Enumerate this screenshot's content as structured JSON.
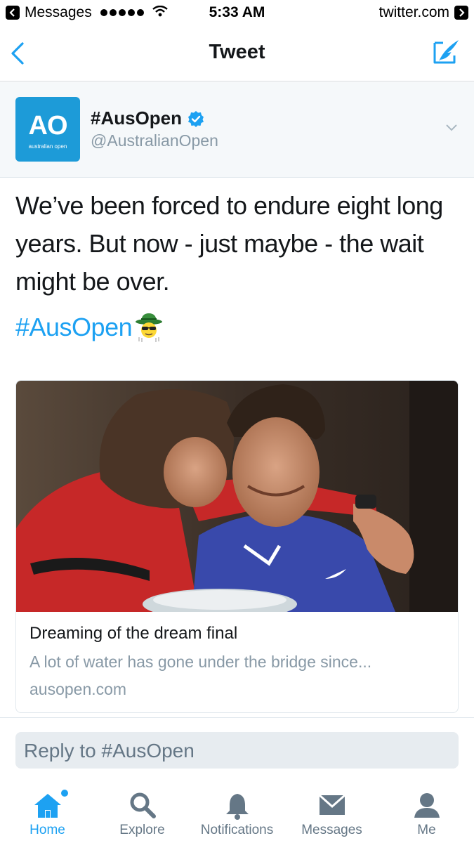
{
  "status_bar": {
    "back_app": "Messages",
    "time": "5:33 AM",
    "site": "twitter.com"
  },
  "nav": {
    "title": "Tweet"
  },
  "author": {
    "name": "#AusOpen",
    "handle": "@AustralianOpen",
    "avatar_text": "AO",
    "avatar_subtext": "australian open",
    "verified": true
  },
  "tweet": {
    "text": "We’ve been forced to endure eight long years. But now - just maybe - the wait might be over.",
    "hashtag": "#AusOpen",
    "emoji": "cowboy-hat-sunglasses-emoji"
  },
  "card": {
    "image": "photo of two tennis players embracing with a trophy",
    "title": "Dreaming of the dream final",
    "description": "A lot of water has gone under the bridge since...",
    "domain": "ausopen.com"
  },
  "reply": {
    "placeholder": "Reply to #AusOpen"
  },
  "tabs": [
    {
      "label": "Home",
      "icon": "home-icon",
      "active": true,
      "has_dot": true
    },
    {
      "label": "Explore",
      "icon": "search-icon",
      "active": false
    },
    {
      "label": "Notifications",
      "icon": "bell-icon",
      "active": false
    },
    {
      "label": "Messages",
      "icon": "envelope-icon",
      "active": false
    },
    {
      "label": "Me",
      "icon": "person-icon",
      "active": false
    }
  ],
  "colors": {
    "accent": "#1da1f2",
    "avatar_bg": "#1d9bd8",
    "muted_text": "#8899a6"
  }
}
